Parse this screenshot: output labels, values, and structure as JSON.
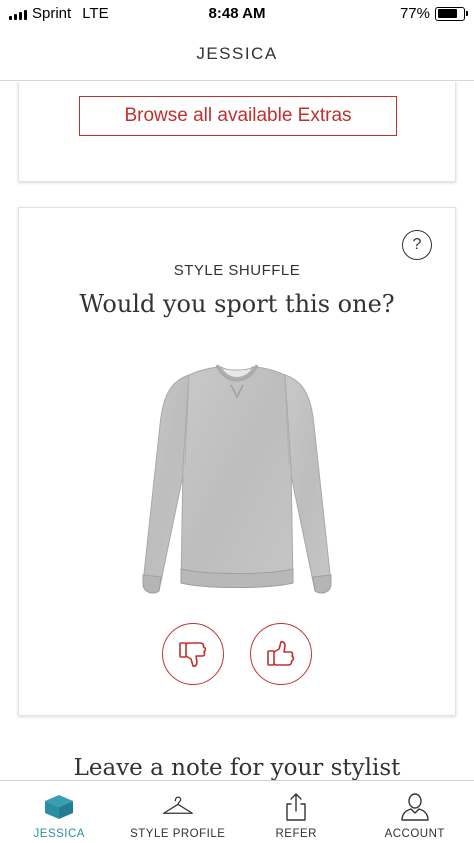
{
  "status_bar": {
    "carrier": "Sprint",
    "network": "LTE",
    "time": "8:48 AM",
    "battery_text": "77%",
    "battery_level": 0.77
  },
  "header": {
    "title": "JESSICA"
  },
  "extras": {
    "button_label": "Browse all available Extras"
  },
  "style_shuffle": {
    "label": "STYLE SHUFFLE",
    "question": "Would you sport this one?",
    "help_icon": "question-circle-icon",
    "product_icon": "gray-sweatshirt-image",
    "dislike_icon": "thumbs-down-icon",
    "like_icon": "thumbs-up-icon"
  },
  "note": {
    "heading": "Leave a note for your stylist"
  },
  "bottom_nav": {
    "items": [
      {
        "label": "JESSICA",
        "icon": "box-icon",
        "active": true
      },
      {
        "label": "STYLE PROFILE",
        "icon": "hanger-icon",
        "active": false
      },
      {
        "label": "REFER",
        "icon": "share-icon",
        "active": false
      },
      {
        "label": "ACCOUNT",
        "icon": "person-icon",
        "active": false
      }
    ]
  },
  "colors": {
    "accent_red": "#c0312e",
    "active_teal": "#2a8fa3",
    "text": "#333333"
  }
}
